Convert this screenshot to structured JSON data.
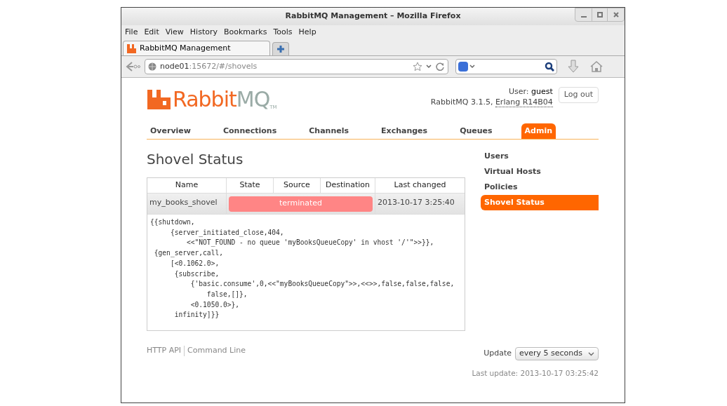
{
  "window": {
    "title": "RabbitMQ Management – Mozilla Firefox"
  },
  "menu": [
    {
      "label": "File"
    },
    {
      "label": "Edit"
    },
    {
      "label": "View"
    },
    {
      "label": "History"
    },
    {
      "label": "Bookmarks"
    },
    {
      "label": "Tools"
    },
    {
      "label": "Help"
    }
  ],
  "browser_tabs": [
    {
      "label": "RabbitMQ Management",
      "selected": true
    }
  ],
  "address_bar": {
    "host": "node01",
    "path": ":15672/#/shovels"
  },
  "logo": {
    "parts": [
      "Rabbit",
      "MQ"
    ],
    "mark": "TM"
  },
  "header": {
    "user_label": "User:",
    "user": "guest",
    "version": "RabbitMQ 3.1.5,",
    "erlang": "Erlang R14B04",
    "logout": "Log out"
  },
  "nav_tabs": [
    {
      "label": "Overview",
      "selected": false
    },
    {
      "label": "Connections",
      "selected": false
    },
    {
      "label": "Channels",
      "selected": false
    },
    {
      "label": "Exchanges",
      "selected": false
    },
    {
      "label": "Queues",
      "selected": false
    },
    {
      "label": "Admin",
      "selected": true
    }
  ],
  "page_title": "Shovel Status",
  "table": {
    "columns": [
      "Name",
      "State",
      "Source",
      "Destination",
      "Last changed"
    ],
    "rows": [
      {
        "name": "my_books_shovel",
        "state": "terminated",
        "color": "#ff8585",
        "last_changed": "2013-10-17 3:25:40",
        "error": "{{shutdown,\n     {server_initiated_close,404,\n         <<\"NOT_FOUND - no queue 'myBooksQueueCopy' in vhost '/'\">>}},\n {gen_server,call,\n     [<0.1062.0>,\n      {subscribe,\n          {'basic.consume',0,<<\"myBooksQueueCopy\">>,<<>>,false,false,false,\n              false,[]},\n          <0.1050.0>},\n      infinity]}}"
      }
    ]
  },
  "sidebar": {
    "items": [
      {
        "label": "Users",
        "selected": false
      },
      {
        "label": "Virtual Hosts",
        "selected": false
      },
      {
        "label": "Policies",
        "selected": false
      },
      {
        "label": "Shovel Status",
        "selected": true
      }
    ]
  },
  "footer": {
    "links": [
      "HTTP API",
      "Command Line"
    ],
    "update_label": "Update",
    "update_value": "every 5 seconds",
    "last_update": "Last update: 2013-10-17 03:25:42"
  }
}
